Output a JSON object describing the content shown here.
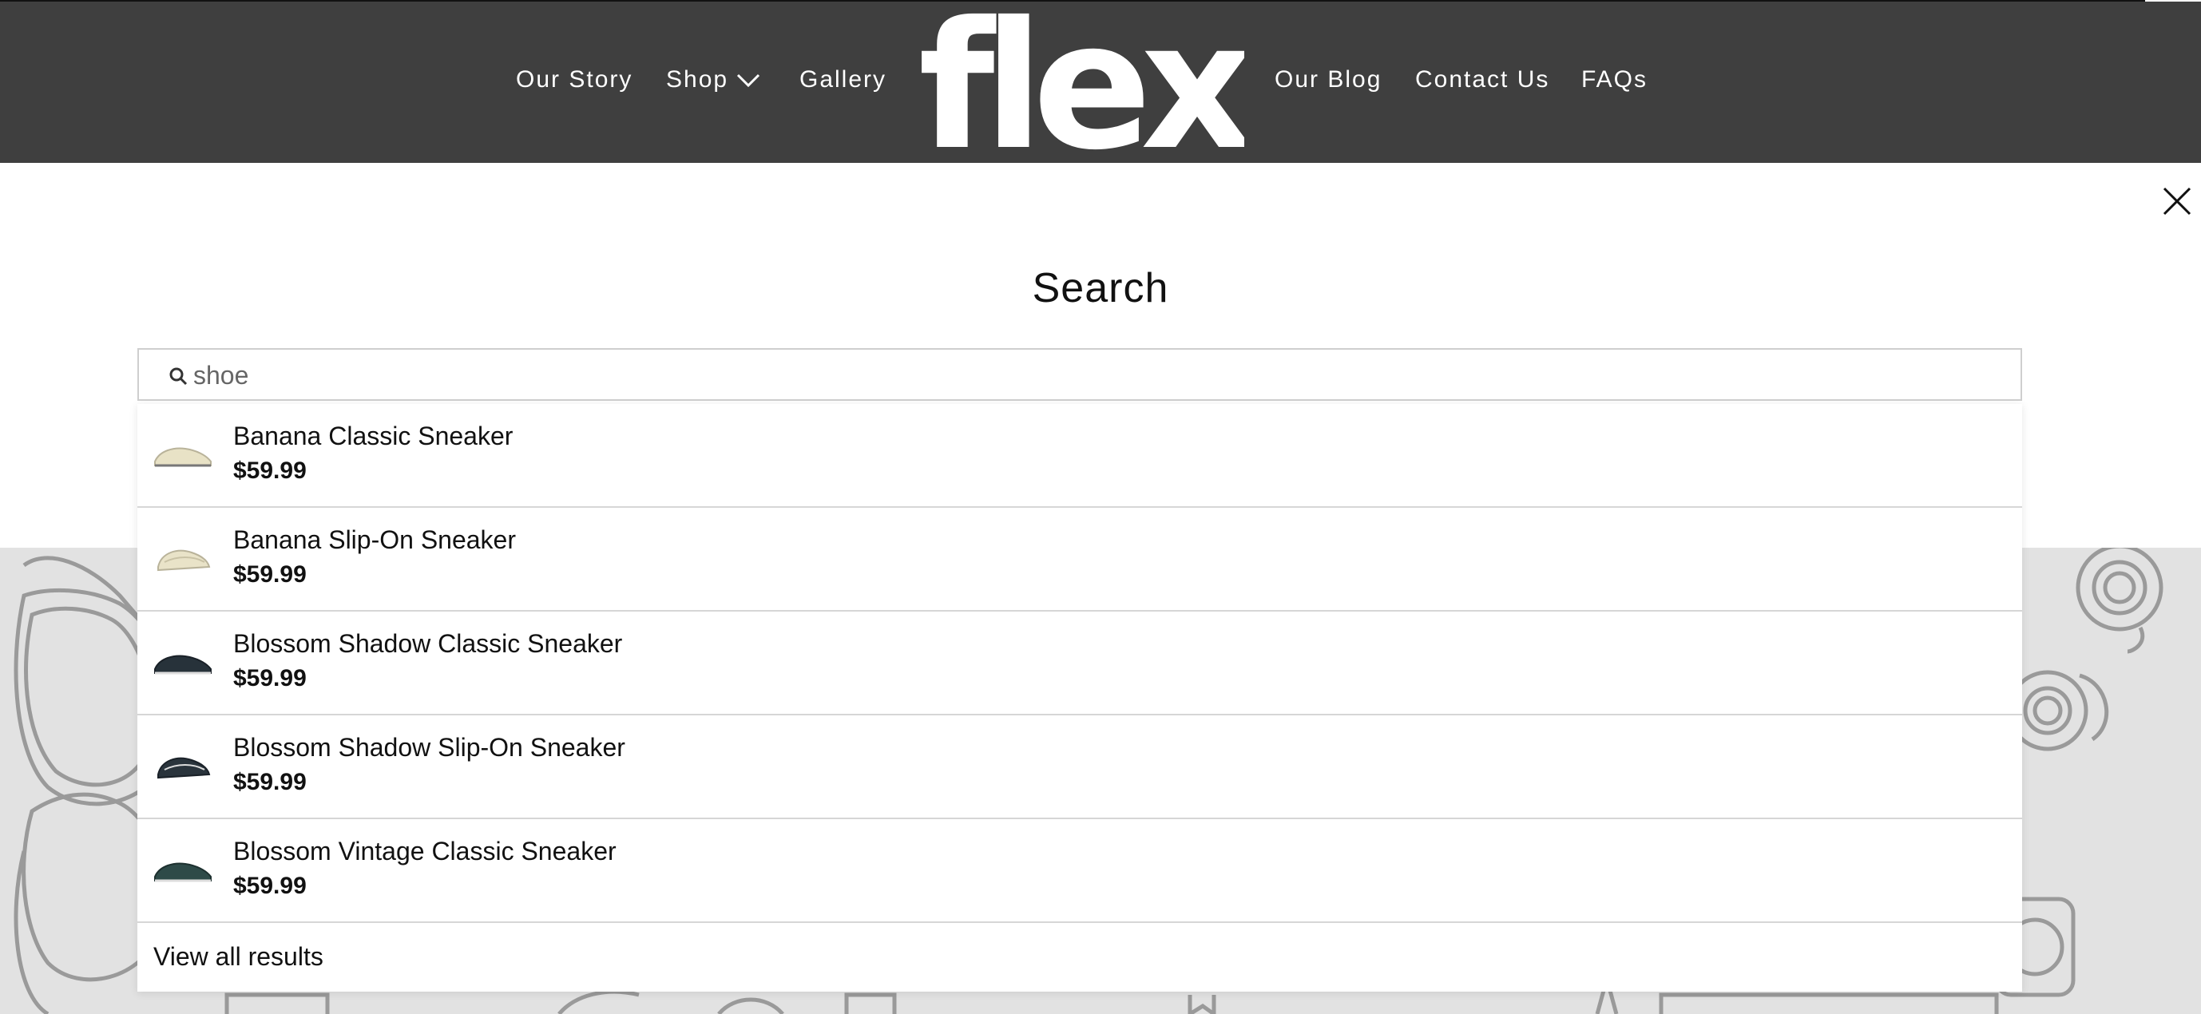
{
  "header": {
    "nav_left": [
      "Our Story",
      "Shop",
      "Gallery"
    ],
    "logo_text": "flex",
    "nav_right": [
      "Our Blog",
      "Contact Us",
      "FAQs"
    ],
    "shop_icon": "chevron-down-icon"
  },
  "search": {
    "title": "Search",
    "query": "shoe",
    "icon": "search-icon",
    "close_icon": "close-icon"
  },
  "results": [
    {
      "name": "Banana Classic Sneaker",
      "price": "$59.99",
      "thumb_color": "#e8e2c6"
    },
    {
      "name": "Banana Slip-On Sneaker",
      "price": "$59.99",
      "thumb_color": "#e9e3c8"
    },
    {
      "name": "Blossom Shadow Classic Sneaker",
      "price": "$59.99",
      "thumb_color": "#27323a"
    },
    {
      "name": "Blossom Shadow Slip-On Sneaker",
      "price": "$59.99",
      "thumb_color": "#2a343c"
    },
    {
      "name": "Blossom Vintage Classic Sneaker",
      "price": "$59.99",
      "thumb_color": "#2e4a48"
    }
  ],
  "view_all_label": "View all results",
  "colors": {
    "header_bg": "#3f3f3f",
    "deco_bg": "#e2e2e2",
    "border": "#d6d6d6"
  }
}
